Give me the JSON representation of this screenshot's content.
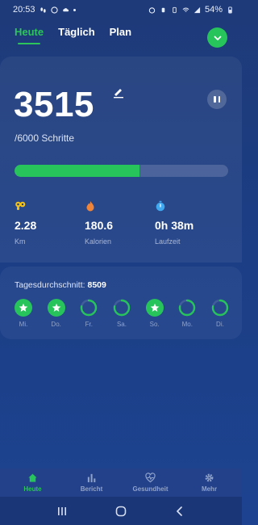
{
  "status_bar": {
    "time": "20:53",
    "battery": "54%"
  },
  "tabs": [
    {
      "label": "Heute",
      "active": true
    },
    {
      "label": "Täglich",
      "active": false
    },
    {
      "label": "Plan",
      "active": false
    }
  ],
  "today": {
    "steps": "3515",
    "goal_text": "/6000 Schritte",
    "progress_fraction": 0.586,
    "stats": [
      {
        "icon": "footprints-icon",
        "value": "2.28",
        "label": "Km"
      },
      {
        "icon": "flame-icon",
        "value": "180.6",
        "label": "Kalorien"
      },
      {
        "icon": "stopwatch-icon",
        "value": "0h 38m",
        "label": "Laufzeit"
      }
    ]
  },
  "average": {
    "label": "Tagesdurchschnitt:",
    "value": "8509",
    "days": [
      {
        "label": "Mi.",
        "done": true
      },
      {
        "label": "Do.",
        "done": true
      },
      {
        "label": "Fr.",
        "done": false
      },
      {
        "label": "Sa.",
        "done": false
      },
      {
        "label": "So.",
        "done": true
      },
      {
        "label": "Mo.",
        "done": false
      },
      {
        "label": "Di.",
        "done": false
      }
    ]
  },
  "bottom_nav": [
    {
      "label": "Heute",
      "icon": "home-icon",
      "active": true
    },
    {
      "label": "Bericht",
      "icon": "bar-chart-icon",
      "active": false
    },
    {
      "label": "Gesundheit",
      "icon": "heart-pulse-icon",
      "active": false
    },
    {
      "label": "Mehr",
      "icon": "gear-icon",
      "active": false
    }
  ],
  "colors": {
    "accent": "#27c35b",
    "background": "#1e3a78",
    "muted_text": "#8fa2c9"
  }
}
